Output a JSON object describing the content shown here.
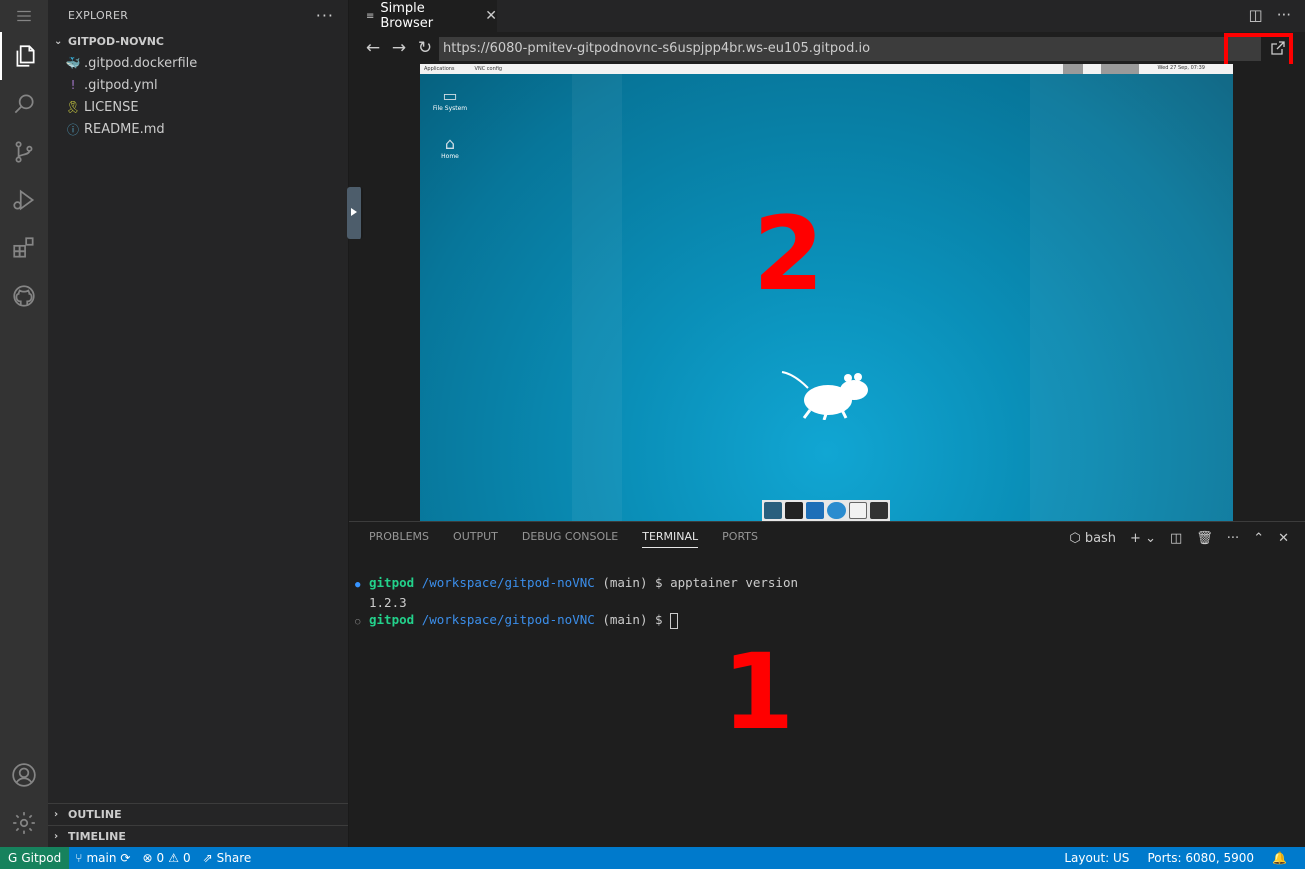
{
  "sidebar": {
    "header": "EXPLORER",
    "more": "···",
    "folder": "GITPOD-NOVNC",
    "files": [
      {
        "name": ".gitpod.dockerfile",
        "icon": "docker-icon",
        "glyph": "🐳",
        "color": "#4aa8d8"
      },
      {
        "name": ".gitpod.yml",
        "icon": "exclamation-icon",
        "glyph": "!",
        "color": "#a074c4"
      },
      {
        "name": "LICENSE",
        "icon": "license-icon",
        "glyph": "🎗",
        "color": "#cbcb41"
      },
      {
        "name": "README.md",
        "icon": "info-icon",
        "glyph": "ⓘ",
        "color": "#519aba"
      }
    ],
    "outline": "OUTLINE",
    "timeline": "TIMELINE"
  },
  "editor": {
    "tab_label": "Simple Browser",
    "tab_close": "✕",
    "url": "https://6080-pmitev-gitpodnovnc-s6uspjpp4br.ws-eu105.gitpod.io"
  },
  "desktop": {
    "panel_apps": "Applications",
    "panel_task": "VNC config",
    "panel_clock": "Wed 27 Sep, 07:39",
    "icons": [
      {
        "label": "File System"
      },
      {
        "label": "Home"
      }
    ],
    "annotation": "2"
  },
  "panel": {
    "tabs": [
      "PROBLEMS",
      "OUTPUT",
      "DEBUG CONSOLE",
      "TERMINAL",
      "PORTS"
    ],
    "active_tab": "TERMINAL",
    "shell": "bash",
    "terminal": {
      "user": "gitpod",
      "path": "/workspace/gitpod-noVNC",
      "branch": "(main)",
      "prompt": "$",
      "command": "apptainer version",
      "output": "1.2.3"
    },
    "annotation": "1"
  },
  "status": {
    "remote": "Gitpod",
    "branch": "main",
    "errors": "0",
    "warnings": "0",
    "share": "Share",
    "layout": "Layout: US",
    "ports": "Ports: 6080, 5900"
  },
  "colors": {
    "accent": "#007acc",
    "remote": "#16825d",
    "annotation": "#ff0000"
  }
}
